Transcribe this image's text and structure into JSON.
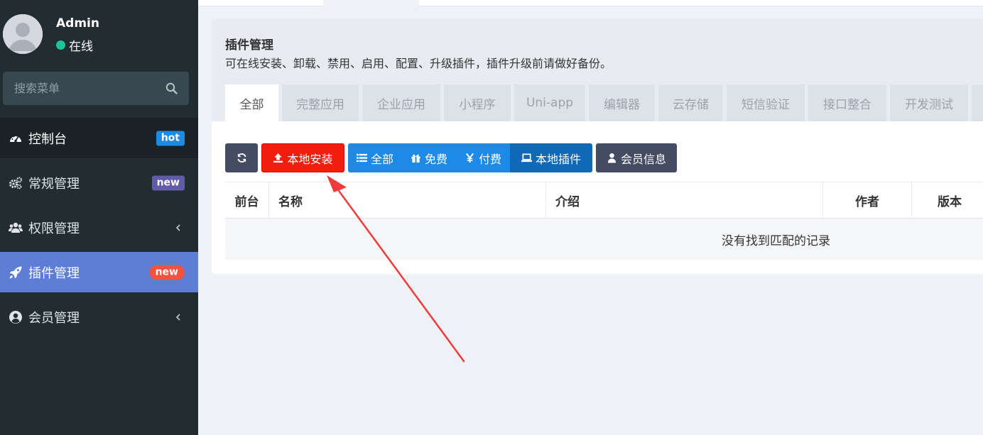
{
  "user": {
    "name": "Admin",
    "status": "在线"
  },
  "search": {
    "placeholder": "搜索菜单"
  },
  "menu": [
    {
      "label": "控制台",
      "badge": "hot",
      "icon": "dashboard-icon"
    },
    {
      "label": "常规管理",
      "badge": "new",
      "icon": "cogs-icon"
    },
    {
      "label": "权限管理",
      "icon": "users-icon"
    },
    {
      "label": "插件管理",
      "badge": "new",
      "icon": "rocket-icon"
    },
    {
      "label": "会员管理",
      "icon": "user-circle-icon"
    }
  ],
  "page": {
    "title": "插件管理",
    "description": "可在线安装、卸载、禁用、启用、配置、升级插件，插件升级前请做好备份。"
  },
  "tabs": [
    "全部",
    "完整应用",
    "企业应用",
    "小程序",
    "Uni-app",
    "编辑器",
    "云存储",
    "短信验证",
    "接口整合",
    "开发测试"
  ],
  "toolbar": {
    "local_install": "本地安装",
    "filter_all": "全部",
    "filter_free": "免费",
    "filter_paid": "付费",
    "filter_local": "本地插件",
    "member_info": "会员信息"
  },
  "table": {
    "columns": [
      "前台",
      "名称",
      "介绍",
      "作者",
      "版本"
    ],
    "empty_text": "没有找到匹配的记录"
  },
  "colors": {
    "sidebar_bg": "#222d32",
    "active_menu": "#5e7ed6",
    "danger": "#f01e0f",
    "primary": "#1c8ae6",
    "annotation_arrow": "#ef3b3b"
  }
}
